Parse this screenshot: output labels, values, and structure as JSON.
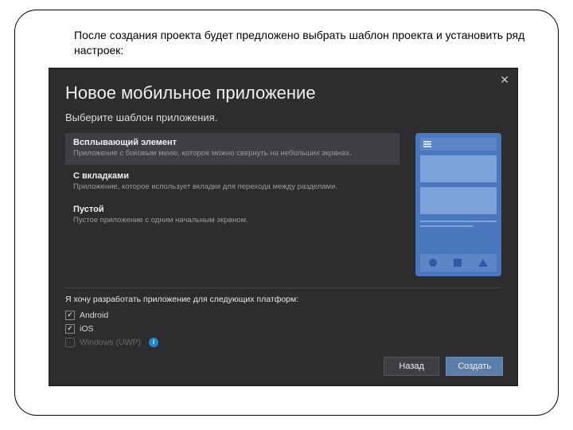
{
  "caption": "После создания проекта будет предложено выбрать шаблон проекта и установить ряд настроек:",
  "dialog": {
    "title": "Новое мобильное приложение",
    "subtitle": "Выберите шаблон приложения.",
    "close": "✕"
  },
  "templates": [
    {
      "name": "Всплывающий элемент",
      "desc": "Приложение с боковым меню, которое можно свернуть на небольших экранах.",
      "selected": true
    },
    {
      "name": "С вкладками",
      "desc": "Приложение, которое использует вкладки для перехода между разделами.",
      "selected": false
    },
    {
      "name": "Пустой",
      "desc": "Пустое приложение с одним начальным экраном.",
      "selected": false
    }
  ],
  "platforms": {
    "label": "Я хочу разработать приложение для следующих платформ:",
    "items": [
      {
        "name": "Android",
        "checked": true,
        "disabled": false,
        "info": false
      },
      {
        "name": "iOS",
        "checked": true,
        "disabled": false,
        "info": false
      },
      {
        "name": "Windows (UWP)",
        "checked": false,
        "disabled": true,
        "info": true
      }
    ]
  },
  "buttons": {
    "back": "Назад",
    "create": "Создать"
  }
}
